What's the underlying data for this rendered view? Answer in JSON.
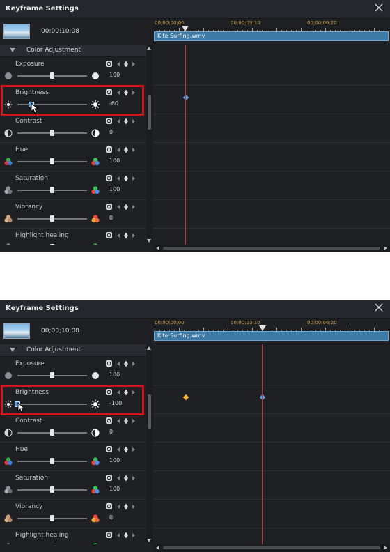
{
  "window": {
    "title": "Keyframe Settings"
  },
  "clip": {
    "timecode": "00;00;10;08",
    "name": "Kite Surfing.wmv"
  },
  "ruler": {
    "labels": [
      "00;00;00;00",
      "00;00;03;10",
      "00;00;06;20"
    ]
  },
  "section": {
    "label": "Color Adjustment"
  },
  "params": [
    {
      "name": "Exposure",
      "value": "100",
      "fraction": 0.5
    },
    {
      "name": "Brightness",
      "value": "-60",
      "fraction": 0.2
    },
    {
      "name": "Contrast",
      "value": "0",
      "fraction": 0.5
    },
    {
      "name": "Hue",
      "value": "100",
      "fraction": 0.5
    },
    {
      "name": "Saturation",
      "value": "100",
      "fraction": 0.5
    },
    {
      "name": "Vibrancy",
      "value": "0",
      "fraction": 0.5
    },
    {
      "name": "Highlight healing",
      "value": "",
      "fraction": 0.5
    }
  ],
  "panel2": {
    "brightness_value": "-100",
    "brightness_fraction": 0.0
  },
  "colors": {
    "accent_red": "#d4161c",
    "keyframe_blue": "#5aa0e0",
    "keyframe_orange": "#f2b13a",
    "playhead": "#d9282e"
  }
}
